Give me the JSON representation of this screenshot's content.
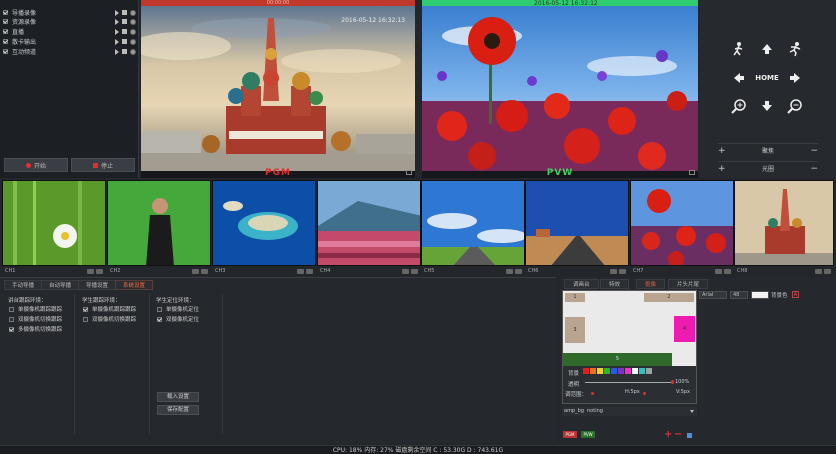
{
  "control_panel": {
    "rows": [
      {
        "label": "导播录像",
        "checked": true
      },
      {
        "label": "资源录像",
        "checked": true
      },
      {
        "label": "直播",
        "checked": true
      },
      {
        "label": "散卡输出",
        "checked": true
      },
      {
        "label": "互动频道",
        "checked": true
      }
    ],
    "start_label": "开始",
    "stop_label": "停止"
  },
  "pgm": {
    "label": "PGM",
    "tally_time": "00:00:00",
    "stamp": "2016-05-12 16:32:13",
    "tally_color": "#c0392b"
  },
  "pvw": {
    "label": "PVW",
    "stamp": "2016-05-12 16:32:12",
    "tally_color": "#2ecc71"
  },
  "ptz": {
    "home_label": "HOME",
    "focus_label": "聚焦",
    "iris_label": "光圈",
    "plus": "+",
    "minus": "−"
  },
  "channels": [
    {
      "label": "CH1"
    },
    {
      "label": "CH2"
    },
    {
      "label": "CH3"
    },
    {
      "label": "CH4"
    },
    {
      "label": "CH5"
    },
    {
      "label": "CH6"
    },
    {
      "label": "CH7"
    },
    {
      "label": "CH8"
    }
  ],
  "tabs": {
    "items": [
      "手动导播",
      "自动导播",
      "导播设置",
      "系统设置"
    ],
    "active_index": 3,
    "groups": {
      "teacher": {
        "title": "讲台跟踪环境：",
        "options": [
          {
            "label": "单摄像机跟踪跟踪",
            "checked": false
          },
          {
            "label": "双摄像机切换跟踪",
            "checked": false
          },
          {
            "label": "多摄像机切换跟踪",
            "checked": true
          }
        ]
      },
      "student": {
        "title": "学生跟踪环境：",
        "options": [
          {
            "label": "单摄像机跟踪跟踪",
            "checked": true
          },
          {
            "label": "双摄像机切换跟踪",
            "checked": false
          }
        ]
      },
      "locate": {
        "title": "学生定位环境：",
        "options": [
          {
            "label": "单摄像机定位",
            "checked": false
          },
          {
            "label": "双摄像机定位",
            "checked": true
          }
        ]
      }
    },
    "load_settings": "载入设置",
    "save_settings": "保存配置"
  },
  "right_panel": {
    "tabs": [
      "调画台",
      "特效",
      "抠像",
      "片头片尾"
    ],
    "active_index": 2,
    "font_select": "Arial",
    "size_select": "48",
    "bg_color_label": "背景色",
    "layer_labels": [
      "1",
      "2",
      "3",
      "4",
      "5"
    ],
    "layer_colors": {
      "1": "#b9a48f",
      "2": "#b9a48f",
      "3": "#b9a48f",
      "4": "#ee1bb0",
      "5": "#2f6a2a"
    },
    "bg_label": "背景",
    "transparency_label": "透明",
    "transparency_value": "100%",
    "range_label": "调范围：",
    "h_label": "H:5px",
    "v_label": "V:5px",
    "bg_file": "amp_bg",
    "bg_mode": "noting",
    "swatches": [
      "#e02020",
      "#f07020",
      "#f0d020",
      "#30b030",
      "#2060e0",
      "#8030c0",
      "#f030c0",
      "#ffffff",
      "#30c0c0",
      "#a0a0a0"
    ],
    "preview_label": "PGM",
    "preview_label2": "PVW"
  },
  "status": {
    "text": "CPU: 18% 内存: 27% 磁盘剩余空间 C : 53.30G D : 743.61G"
  }
}
